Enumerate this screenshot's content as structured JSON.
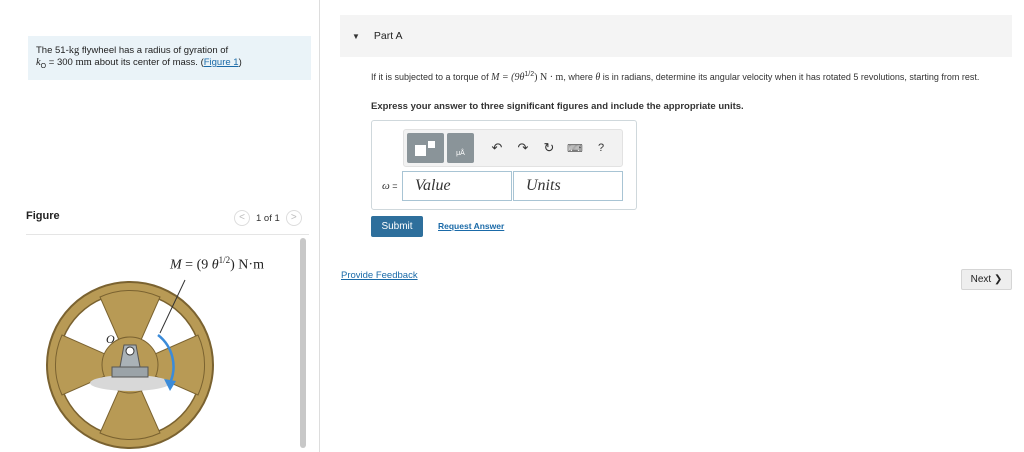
{
  "problem": {
    "text_before_mass": "The 51-",
    "mass_unit": "kg",
    "text_after_mass": " flywheel has a radius of gyration of",
    "k_symbol": "k",
    "k_subscript": "O",
    "k_equals": " = 300 ",
    "k_unit": "mm",
    "text_center": " about its center of mass. (",
    "figure_link": "Figure 1",
    "text_close": ")"
  },
  "figure": {
    "label": "Figure",
    "pager_text": "1 of 1",
    "torque_label": "M = (9 θ1/2) N·m",
    "point_label": "O"
  },
  "part": {
    "title": "Part A",
    "question_text_1": "If it is subjected to a torque of ",
    "question_math": "M = (9θ",
    "question_exp": "1/2",
    "question_math_end": ") N · m",
    "question_text_2": ", where ",
    "question_theta": "θ",
    "question_text_3": " is in radians, determine its angular velocity when it has rotated 5 revolutions, starting from rest.",
    "instruction": "Express your answer to three significant figures and include the appropriate units."
  },
  "answer": {
    "omega_symbol": "ω",
    "omega_equals": " =",
    "value_placeholder": "Value",
    "units_placeholder": "Units"
  },
  "toolbar": {
    "undo_icon": "↶",
    "redo_icon": "↷",
    "reset_icon": "↻",
    "keyboard_icon": "⌨",
    "help_label": "?"
  },
  "actions": {
    "submit_label": "Submit",
    "request_answer_label": "Request Answer",
    "feedback_label": "Provide Feedback",
    "next_label": "Next ❯"
  },
  "colors": {
    "accent": "#2e6f9c",
    "link": "#1a6aa8",
    "problem_bg": "#eaf3f8",
    "wheel": "#b89a55"
  }
}
